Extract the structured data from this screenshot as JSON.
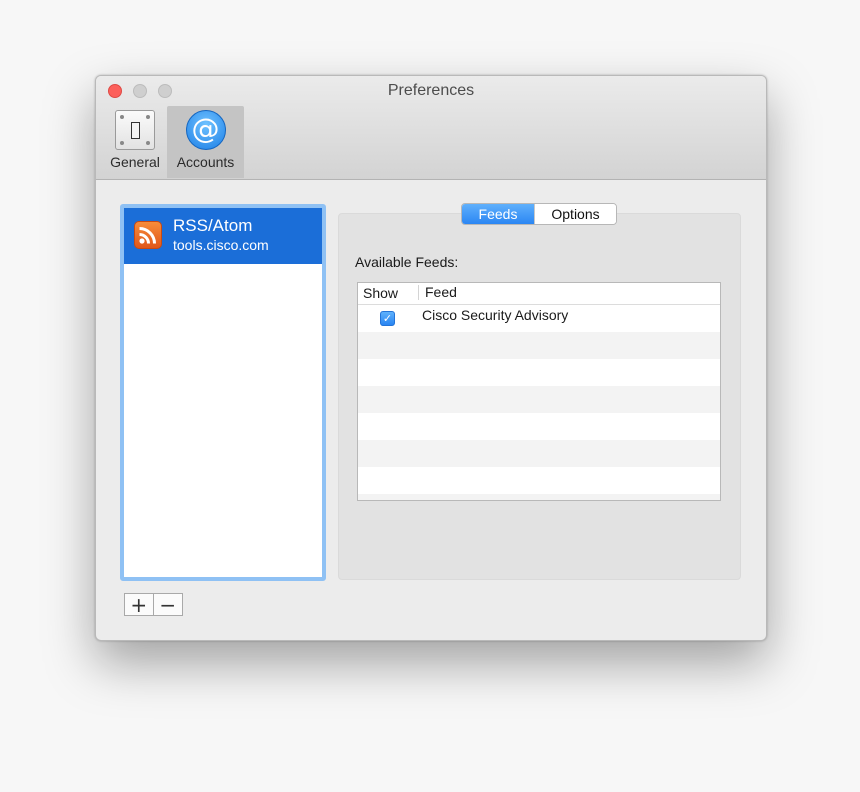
{
  "window": {
    "title": "Preferences"
  },
  "toolbar": {
    "items": [
      {
        "label": "General",
        "icon": "switch-icon",
        "selected": false
      },
      {
        "label": "Accounts",
        "icon": "at-sign-icon",
        "selected": true
      }
    ]
  },
  "accounts": {
    "items": [
      {
        "name": "RSS/Atom",
        "host": "tools.cisco.com",
        "icon": "rss-icon",
        "selected": true
      }
    ],
    "add_label": "+",
    "remove_label": "−"
  },
  "detail": {
    "tabs": [
      {
        "label": "Feeds",
        "selected": true
      },
      {
        "label": "Options",
        "selected": false
      }
    ],
    "available_label": "Available Feeds:",
    "table": {
      "columns": [
        "Show",
        "Feed"
      ],
      "rows": [
        {
          "show": true,
          "feed": "Cisco Security Advisory"
        }
      ]
    }
  },
  "colors": {
    "accent": "#1b6ed8",
    "selection_ring": "#8fc1f4",
    "close": "#fc605b",
    "rss": "#e86a27"
  }
}
